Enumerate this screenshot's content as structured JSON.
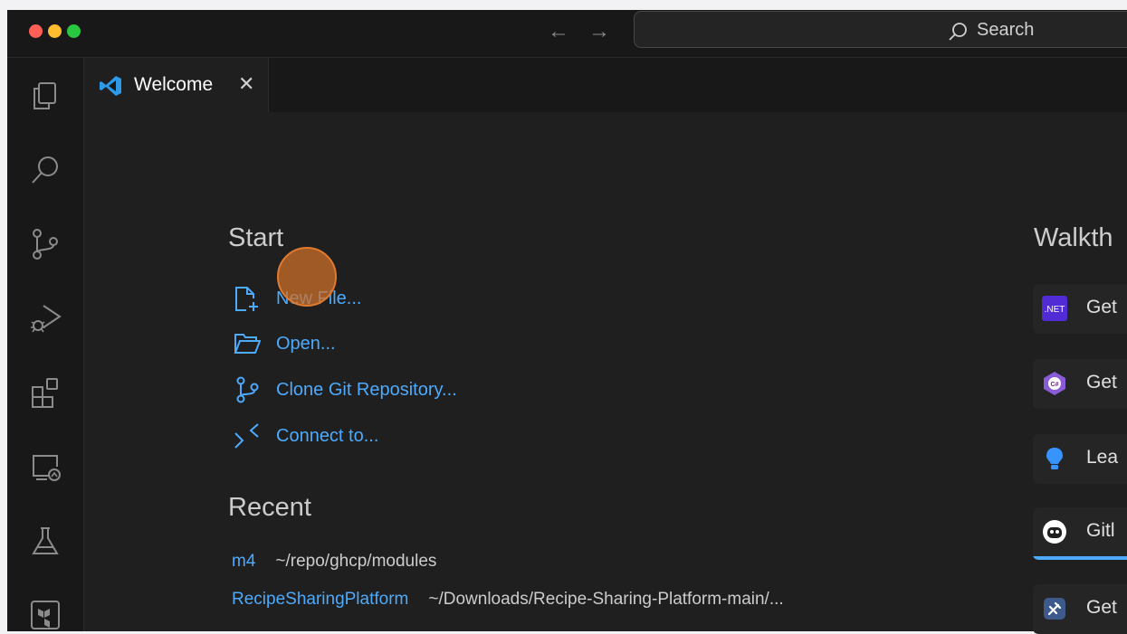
{
  "titlebar": {
    "search_placeholder": "Search",
    "back_icon": "arrow-left-icon",
    "forward_icon": "arrow-right-icon"
  },
  "activity_bar": {
    "items": [
      {
        "icon": "explorer-icon"
      },
      {
        "icon": "search-icon"
      },
      {
        "icon": "source-control-icon"
      },
      {
        "icon": "run-debug-icon"
      },
      {
        "icon": "extensions-icon"
      },
      {
        "icon": "remote-explorer-icon"
      },
      {
        "icon": "testing-icon"
      },
      {
        "icon": "terraform-icon"
      }
    ]
  },
  "tab": {
    "label": "Welcome",
    "close_glyph": "✕",
    "icon": "vscode-logo-icon"
  },
  "start": {
    "heading": "Start",
    "items": [
      {
        "label": "New File...",
        "icon": "new-file-icon"
      },
      {
        "label": "Open...",
        "icon": "folder-open-icon"
      },
      {
        "label": "Clone Git Repository...",
        "icon": "git-branch-icon"
      },
      {
        "label": "Connect to...",
        "icon": "remote-connect-icon"
      }
    ]
  },
  "recent": {
    "heading": "Recent",
    "items": [
      {
        "name": "m4",
        "path": "~/repo/ghcp/modules"
      },
      {
        "name": "RecipeSharingPlatform",
        "path": "~/Downloads/Recipe-Sharing-Platform-main/..."
      }
    ]
  },
  "walkthroughs": {
    "heading": "Walkth",
    "items": [
      {
        "text": "Get",
        "icon": "dotnet-icon",
        "icon_label": ".NET"
      },
      {
        "text": "Get",
        "icon": "csharp-icon",
        "icon_label": "C#"
      },
      {
        "text": "Lea",
        "icon": "lightbulb-icon"
      },
      {
        "text": "Gitl",
        "icon": "copilot-icon"
      },
      {
        "text": "Get",
        "icon": "tools-icon"
      }
    ]
  },
  "colors": {
    "accent": "#4daafc",
    "background": "#1f1f1f",
    "cursor_highlight": "#d3712a"
  }
}
